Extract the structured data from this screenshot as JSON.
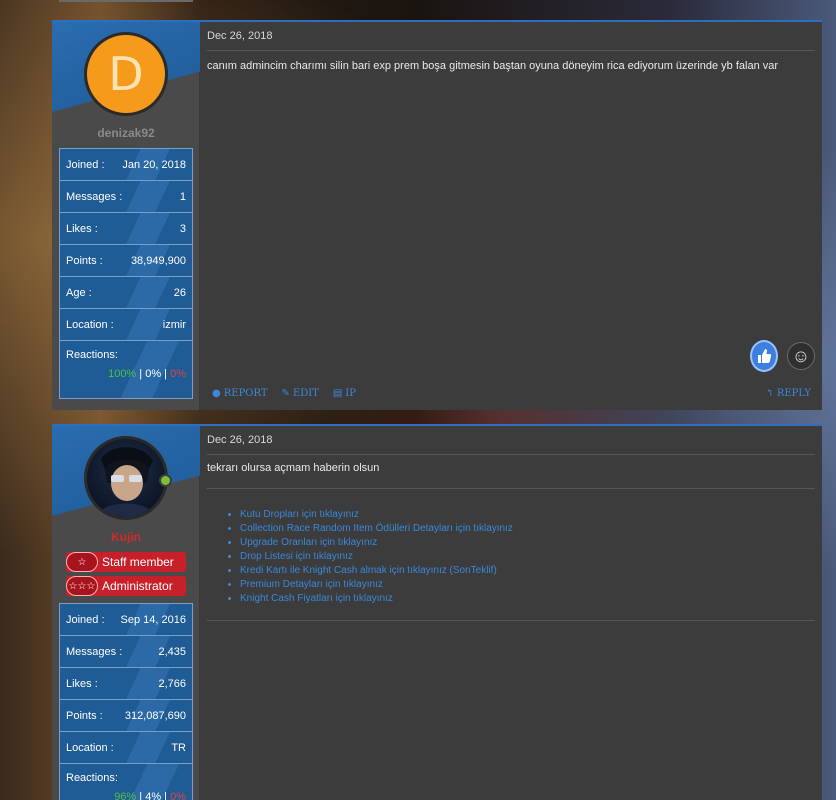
{
  "posts": [
    {
      "username": "denizak92",
      "avatar_letter": "D",
      "stats": [
        {
          "label": "Joined :",
          "value": "Jan 20, 2018"
        },
        {
          "label": "Messages :",
          "value": "1"
        },
        {
          "label": "Likes :",
          "value": "3"
        },
        {
          "label": "Points :",
          "value": "38,949,900"
        },
        {
          "label": "Age :",
          "value": "26"
        },
        {
          "label": "Location :",
          "value": "izmir"
        }
      ],
      "reactions_label": "Reactions:",
      "reactions": {
        "positive": "100%",
        "neutral": "0%",
        "negative": "0%"
      },
      "date": "Dec 26, 2018",
      "message": "canım admincim charımı silin bari exp prem boşa gitmesin baştan oyuna döneyim rica ediyorum üzerinde yb falan var",
      "actions": {
        "report": "REPORT",
        "edit": "EDIT",
        "ip": "IP",
        "reply": "REPLY"
      }
    },
    {
      "username": "Kujin",
      "badges": [
        "Staff member",
        "Administrator"
      ],
      "stats": [
        {
          "label": "Joined :",
          "value": "Sep 14, 2016"
        },
        {
          "label": "Messages :",
          "value": "2,435"
        },
        {
          "label": "Likes :",
          "value": "2,766"
        },
        {
          "label": "Points :",
          "value": "312,087,690"
        },
        {
          "label": "Location :",
          "value": "TR"
        }
      ],
      "reactions_label": "Reactions:",
      "reactions": {
        "positive": "96%",
        "neutral": "4%",
        "negative": "0%"
      },
      "date": "Dec 26, 2018",
      "message": "tekrarı olursa açmam haberin olsun",
      "signature_links": [
        "Kutu Dropları için tıklayınız",
        "Collection Race Random Item Ödülleri Detayları için tıklayınız",
        "Upgrade Oranları için tıklayınız",
        "Drop Listesi için tıklayınız",
        "Kredi Kartı ile Knight Cash almak için tıklayınız (SonTeklif)",
        "Premium Detayları için tıklayınız",
        "Knight Cash Fiyatları için tıklayınız"
      ]
    }
  ],
  "colors": {
    "accent": "#2c6fbf",
    "link": "#3a88d8",
    "staff_badge": "#c8202a"
  },
  "icons": [
    "report-icon",
    "edit-icon",
    "ip-icon",
    "reply-icon",
    "thumbs-up-icon",
    "smiley-icon",
    "star-icon"
  ]
}
